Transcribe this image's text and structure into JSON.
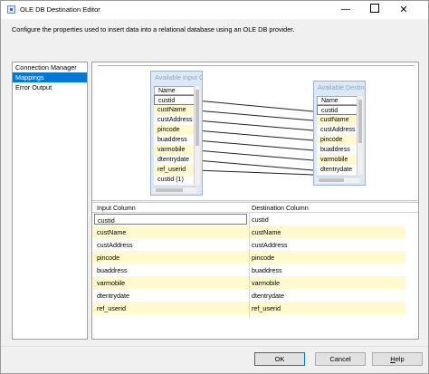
{
  "window": {
    "title": "OLE DB Destination Editor",
    "description": "Configure the properties used to insert data into a relational database using an OLE DB provider."
  },
  "nav": {
    "items": [
      {
        "label": "Connection Manager",
        "selected": false
      },
      {
        "label": "Mappings",
        "selected": true
      },
      {
        "label": "Error Output",
        "selected": false
      }
    ]
  },
  "diagram": {
    "input_table": {
      "title": "Available Input Columns",
      "header": "Name",
      "rows": [
        "custid",
        "custName",
        "custAddress",
        "pincode",
        "buaddress",
        "varmobile",
        "dtentrydate",
        "ref_userid",
        "custid (1)"
      ]
    },
    "destination_table": {
      "title": "Available Destination Columns",
      "header": "Name",
      "rows": [
        "custid",
        "custName",
        "custAddress",
        "pincode",
        "buaddress",
        "varmobile",
        "dtentrydate"
      ]
    }
  },
  "grid": {
    "headers": {
      "input": "Input Column",
      "destination": "Destination Column"
    },
    "rows": [
      {
        "input": "custid",
        "destination": "custid"
      },
      {
        "input": "custName",
        "destination": "custName"
      },
      {
        "input": "custAddress",
        "destination": "custAddress"
      },
      {
        "input": "pincode",
        "destination": "pincode"
      },
      {
        "input": "buaddress",
        "destination": "buaddress"
      },
      {
        "input": "varmobile",
        "destination": "varmobile"
      },
      {
        "input": "dtentrydate",
        "destination": "dtentrydate"
      },
      {
        "input": "ref_userid",
        "destination": "ref_userid"
      }
    ]
  },
  "buttons": {
    "ok": "OK",
    "cancel": "Cancel",
    "help_prefix": "",
    "help_accel": "H",
    "help_rest": "elp"
  },
  "colors": {
    "selection": "#0078d7",
    "row_highlight": "#fffacd",
    "table_fill": "#dbe8f7"
  }
}
